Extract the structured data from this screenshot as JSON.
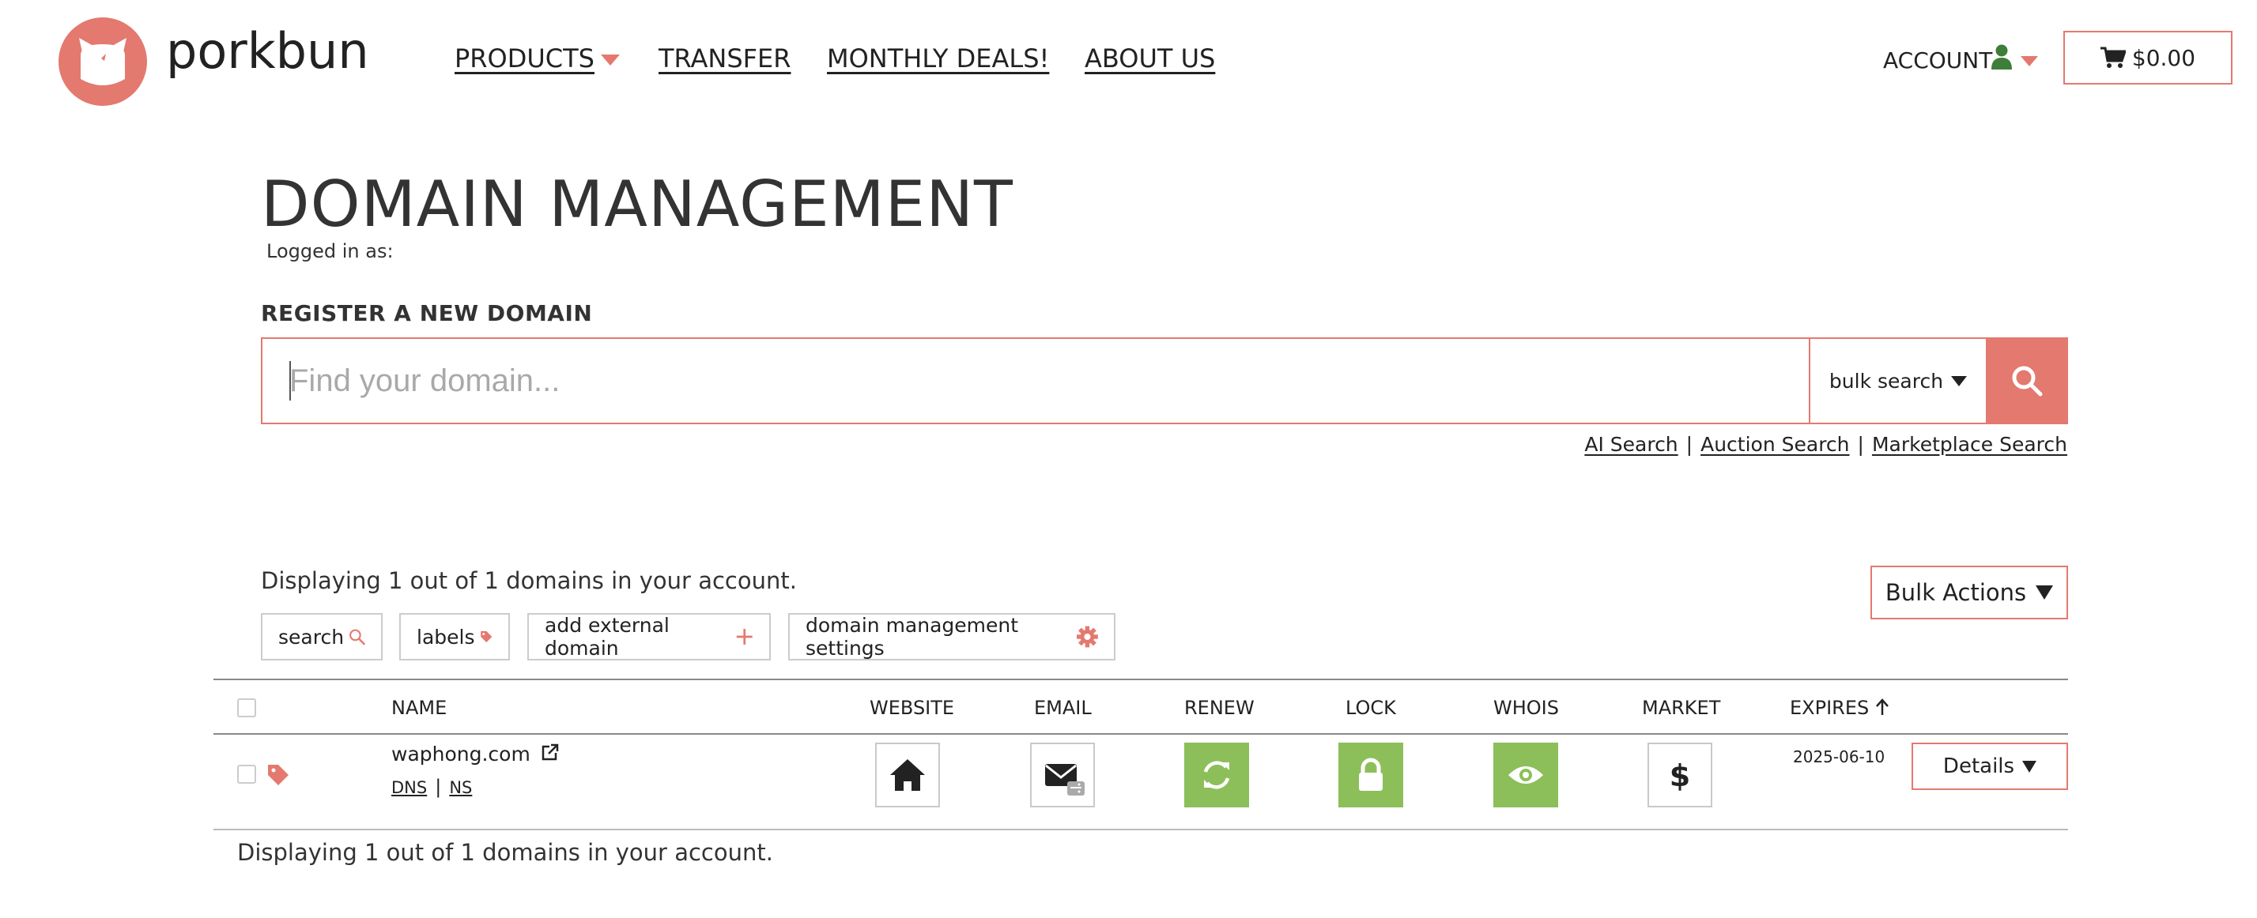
{
  "header": {
    "brand": "porkbun",
    "nav": {
      "products": "PRODUCTS",
      "transfer": "TRANSFER",
      "monthly_deals": "MONTHLY DEALS!",
      "about_us": "ABOUT US"
    },
    "account_label": "ACCOUNT",
    "cart_total": "$0.00"
  },
  "main": {
    "title": "DOMAIN MANAGEMENT",
    "logged_in_label": "Logged in as:",
    "register_label": "REGISTER A NEW DOMAIN",
    "search": {
      "placeholder": "Find your domain...",
      "value": "",
      "bulk_search_label": "bulk search"
    },
    "sub_links": [
      "AI Search",
      "Auction Search",
      "Marketplace Search"
    ],
    "display_text": "Displaying 1 out of 1 domains in your account.",
    "bulk_actions_label": "Bulk Actions",
    "tools": {
      "search": "search",
      "labels": "labels",
      "add_external": "add external domain",
      "settings": "domain management settings"
    }
  },
  "table": {
    "columns": {
      "name": "NAME",
      "website": "WEBSITE",
      "email": "EMAIL",
      "renew": "RENEW",
      "lock": "LOCK",
      "whois": "WHOIS",
      "market": "MARKET",
      "expires": "EXPIRES"
    },
    "rows": [
      {
        "domain": "waphong.com",
        "dns_label": "DNS",
        "ns_label": "NS",
        "expires": "2025-06-10",
        "details_label": "Details",
        "renew_enabled": true,
        "lock_enabled": true,
        "whois_privacy_enabled": true
      }
    ]
  },
  "colors": {
    "accent": "#e4796f",
    "enabled_green": "#8cbf5a",
    "account_icon": "#3f7d3a"
  },
  "icons": {
    "logo": "pig-logo-icon",
    "cart": "cart-icon",
    "account": "user-icon",
    "search": "search-icon",
    "labels": "tag-icon",
    "add": "plus-icon",
    "settings": "gear-icon",
    "external_link": "external-link-icon",
    "website": "home-icon",
    "email": "envelope-icon",
    "renew": "refresh-icon",
    "lock": "lock-icon",
    "whois": "eye-icon",
    "market": "dollar-icon",
    "sort": "arrow-up-icon"
  }
}
